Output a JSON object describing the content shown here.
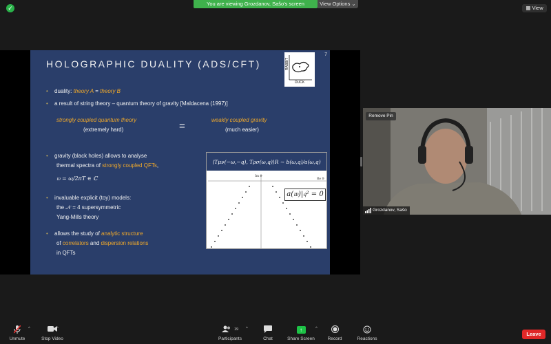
{
  "top": {
    "banner": "You are viewing Grozdanov, Sašo's screen",
    "view_options": "View Options ⌄",
    "view_button": "View"
  },
  "slide": {
    "number": "7",
    "title": "HOLOGRAPHIC DUALITY (ADS/CFT)",
    "logo_top": "RABBIT",
    "logo_bottom": "DUCK",
    "b1_pre": "duality: ",
    "b1_a": "theory A",
    "b1_eq": " = ",
    "b1_b": "theory B",
    "b2": "a result of string theory – quantum theory of gravity [Maldacena (1997)]",
    "left_hl": "strongly coupled quantum theory",
    "left_sub": "(extremely hard)",
    "eq": "=",
    "right_hl": "weakly coupled gravity",
    "right_sub": "(much easier)",
    "b3_l1": "gravity (black holes) allows to analyse",
    "b3_l2_pre": "thermal spectra of ",
    "b3_l2_hl": "strongly coupled QFTs",
    "b3_l2_post": ",",
    "b3_formula": "𝔴 = ω/2πT ∈ ℂ",
    "b4_l1": "invaluable explicit (toy) models:",
    "b4_l2": "the 𝒩 = 4 supersymmetric",
    "b4_l3": "Yang-Mills theory",
    "b5_l1_pre": "allows the study of ",
    "b5_l1_hl": "analytic structure",
    "b5_l2_pre": "of ",
    "b5_l2_hl1": "correlators",
    "b5_l2_mid": " and ",
    "b5_l2_hl2": "dispersion relations",
    "b5_l3": "in QFTs",
    "plot_head": "⟨Tμν(−ω,−q), Tρσ(ω,q)⟩R ∼ b(ω,q)/a(ω,q)",
    "plot_ylabel": "Im 𝔴",
    "plot_xlabel": "Re 𝔴",
    "plot_formula": "a(𝔴)|𝔮² = 0"
  },
  "video": {
    "remove_pin": "Remove Pin",
    "name": "Grozdanov, Sašo"
  },
  "toolbar": {
    "unmute": "Unmute",
    "stop_video": "Stop Video",
    "participants": "Participants",
    "participants_count": "19",
    "chat": "Chat",
    "share": "Share Screen",
    "record": "Record",
    "reactions": "Reactions",
    "leave": "Leave"
  }
}
